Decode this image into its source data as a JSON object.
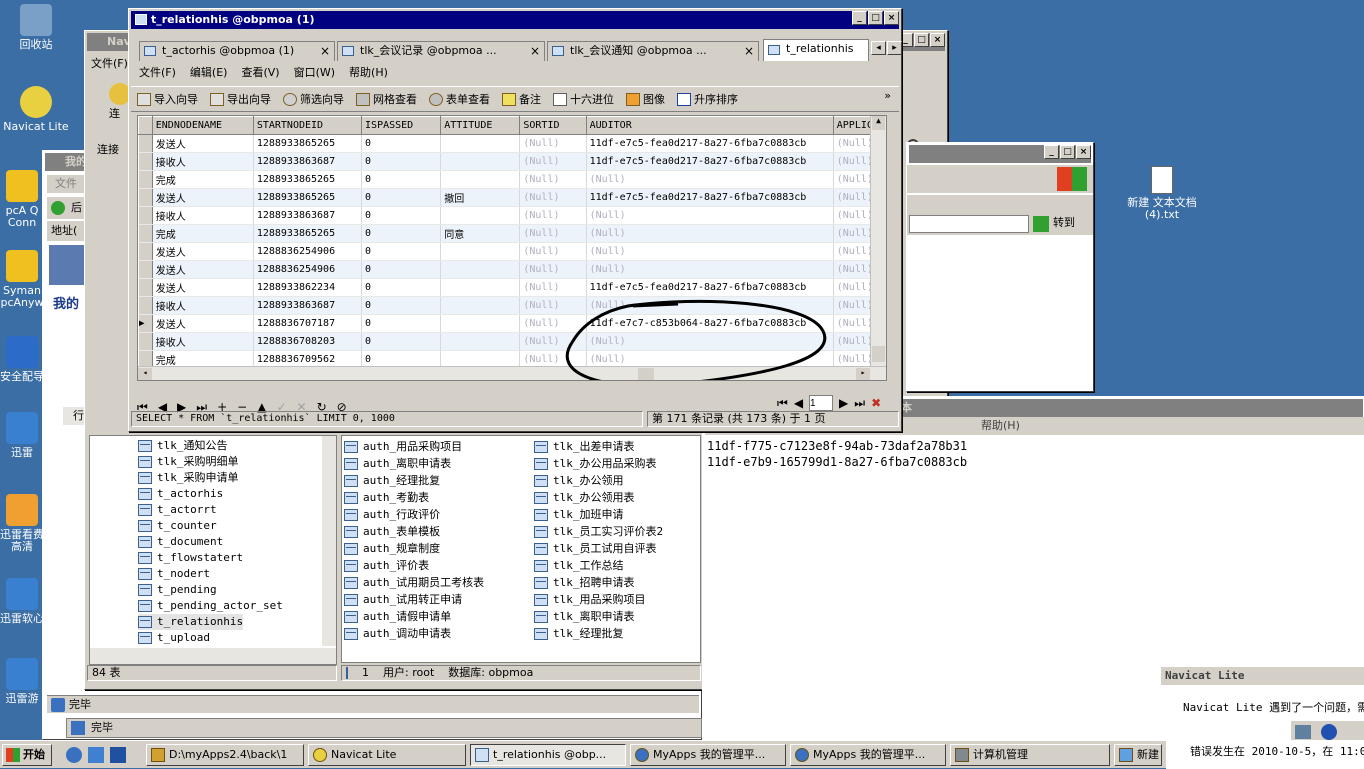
{
  "desktop": {
    "icons": [
      {
        "label": "回收站",
        "color": "#7aa0c8"
      },
      {
        "label": "Navicat Lite",
        "color": "#e8d040"
      },
      {
        "label": "pcA Q Conn",
        "color": "#f0c020"
      },
      {
        "label": "Syman pcAnyw",
        "color": "#f0c020"
      },
      {
        "label": "安全配导",
        "color": "#2c6cc8"
      },
      {
        "label": "迅雷",
        "color": "#3a80d0"
      },
      {
        "label": "迅雷看费高清",
        "color": "#f0a030"
      },
      {
        "label": "迅雷软心",
        "color": "#3a80d0"
      },
      {
        "label": "迅雷游",
        "color": "#3a80d0"
      },
      {
        "label": "新建 文本文档 (4).txt",
        "color": "#ffffff"
      }
    ]
  },
  "main_window": {
    "title": "t_relationhis @obpmoa (1)",
    "tabs": [
      {
        "label": "t_actorhis @obpmoa (1)"
      },
      {
        "label": "tlk_会议记录 @obpmoa ..."
      },
      {
        "label": "tlk_会议通知 @obpmoa ..."
      },
      {
        "label": "t_relationhis"
      }
    ],
    "menu": [
      "文件(F)",
      "编辑(E)",
      "查看(V)",
      "窗口(W)",
      "帮助(H)"
    ],
    "toolbar": [
      "导入向导",
      "导出向导",
      "筛选向导",
      "网格查看",
      "表单查看",
      "备注",
      "十六进位",
      "图像",
      "升序排序"
    ],
    "grid": {
      "columns": [
        "ENDNODENAME",
        "STARTNODEID",
        "ISPASSED",
        "ATTITUDE",
        "SORTID",
        "AUDITOR",
        "APPLICAT"
      ],
      "rows": [
        [
          "发送人",
          "1288933865265",
          "0",
          "",
          "(Null)",
          "11df-e7c5-fea0d217-8a27-6fba7c0883cb",
          "(Null)"
        ],
        [
          "接收人",
          "1288933863687",
          "0",
          "",
          "(Null)",
          "11df-e7c5-fea0d217-8a27-6fba7c0883cb",
          "(Null)"
        ],
        [
          "完成",
          "1288933865265",
          "0",
          "",
          "(Null)",
          "(Null)",
          "(Null)"
        ],
        [
          "发送人",
          "1288933865265",
          "0",
          "撤回",
          "(Null)",
          "11df-e7c5-fea0d217-8a27-6fba7c0883cb",
          "(Null)"
        ],
        [
          "接收人",
          "1288933863687",
          "0",
          "",
          "(Null)",
          "(Null)",
          "(Null)"
        ],
        [
          "完成",
          "1288933865265",
          "0",
          "同意",
          "(Null)",
          "(Null)",
          "(Null)"
        ],
        [
          "发送人",
          "1288836254906",
          "0",
          "",
          "(Null)",
          "(Null)",
          "(Null)"
        ],
        [
          "发送人",
          "1288836254906",
          "0",
          "",
          "(Null)",
          "(Null)",
          "(Null)"
        ],
        [
          "发送人",
          "1288933862234",
          "0",
          "",
          "(Null)",
          "11df-e7c5-fea0d217-8a27-6fba7c0883cb",
          "(Null)"
        ],
        [
          "接收人",
          "1288933863687",
          "0",
          "",
          "(Null)",
          "(Null)",
          "(Null)"
        ],
        [
          "发送人",
          "1288836707187",
          "0",
          "",
          "(Null)",
          "11df-e7c7-c853b064-8a27-6fba7c0883cb",
          "(Null)"
        ],
        [
          "接收人",
          "1288836708203",
          "0",
          "",
          "(Null)",
          "(Null)",
          "(Null)"
        ],
        [
          "完成",
          "1288836709562",
          "0",
          "",
          "(Null)",
          "(Null)",
          "(Null)"
        ]
      ]
    },
    "page_input": "1",
    "sql": "SELECT * FROM `t_relationhis` LIMIT 0, 1000",
    "record_status": "第 171 条记录 (共 173 条) 于 1 页"
  },
  "navicat_window": {
    "title": "Navicat Lite",
    "menu_file": "文件(F)",
    "toolbar_label": "连",
    "connect_label": "连接",
    "tree_items": [
      "tlk_通知公告",
      "tlk_采购明细单",
      "tlk_采购申请单",
      "t_actorhis",
      "t_actorrt",
      "t_counter",
      "t_document",
      "t_flowstatert",
      "t_nodert",
      "t_pending",
      "t_pending_actor_set",
      "t_relationhis",
      "t_upload"
    ],
    "list_col1": [
      "auth_用品采购项目",
      "auth_离职申请表",
      "auth_经理批复",
      "auth_考勤表",
      "auth_行政评价",
      "auth_表单模板",
      "auth_规章制度",
      "auth_评价表",
      "auth_试用期员工考核表",
      "auth_试用转正申请",
      "auth_请假申请单",
      "auth_调动申请表"
    ],
    "list_col2": [
      "tlk_出差申请表",
      "tlk_办公用品采购表",
      "tlk_办公领用",
      "tlk_办公领用表",
      "tlk_加班申请",
      "tlk_员工实习评价表2",
      "tlk_员工试用自评表",
      "tlk_工作总结",
      "tlk_招聘申请表",
      "tlk_用品采购项目",
      "tlk_离职申请表",
      "tlk_经理批复"
    ],
    "status_count": "84 表",
    "status_conn": "1",
    "status_user": "用户: root",
    "status_db": "数据库: obpmoa"
  },
  "ie_window": {
    "title": "我的",
    "menu_file": "文件",
    "back_label": "后",
    "address_label": "地址(",
    "goto_label": "转到",
    "status": "完毕",
    "status2": "完毕",
    "row_label": "行"
  },
  "notepad": {
    "title_suffix": "本",
    "menu_help": "帮助(H)",
    "lines": [
      "11df-f775-c7123e8f-94ab-73daf2a78b31",
      "11df-e7b9-165799d1-8a27-6fba7c0883cb"
    ]
  },
  "error_dialog": {
    "title": "Navicat Lite",
    "message": "Navicat Lite 遇到了一个问题，需",
    "error_line": "错误发生在 2010-10-5，在 11:0"
  },
  "taskbar": {
    "start": "开始",
    "tasks": [
      {
        "label": "D:\\myApps2.4\\back\\1"
      },
      {
        "label": "Navicat Lite"
      },
      {
        "label": "t_relationhis @obp..."
      },
      {
        "label": "MyApps 我的管理平..."
      },
      {
        "label": "MyApps 我的管理平..."
      },
      {
        "label": "计算机管理"
      },
      {
        "label": "新建"
      }
    ]
  }
}
